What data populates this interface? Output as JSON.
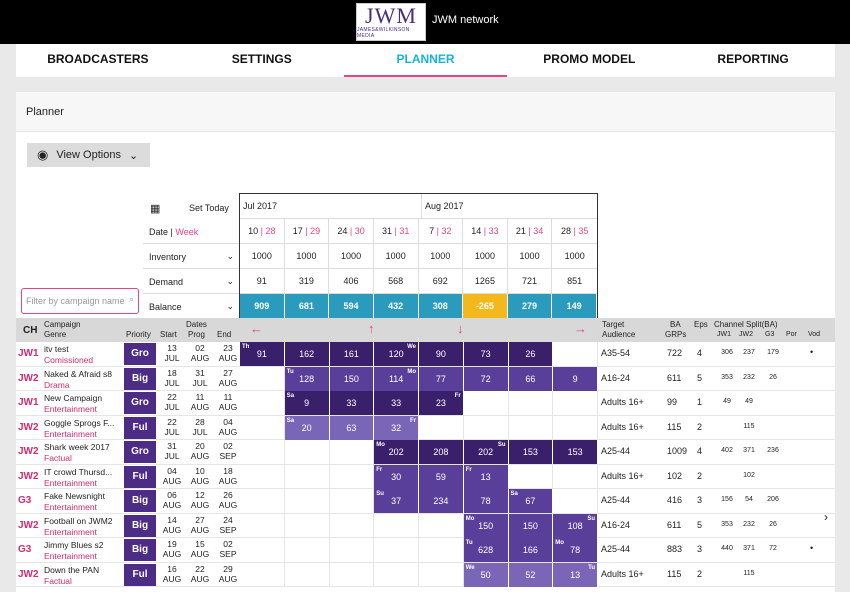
{
  "app": {
    "logo_text": "JWM",
    "logo_sub": "JAMES&WILKINSON MEDIA",
    "brand": "JWM network"
  },
  "nav": [
    "BROADCASTERS",
    "SETTINGS",
    "PLANNER",
    "PROMO MODEL",
    "REPORTING"
  ],
  "panel": {
    "title": "Planner",
    "view_options": "View Options",
    "filter_placeholder": "Filter by campaign name",
    "set_today": "Set Today"
  },
  "months": {
    "jul": "Jul 2017",
    "aug": "Aug 2017"
  },
  "row_labels": {
    "date": "Date",
    "week": "Week",
    "inventory": "Inventory",
    "demand": "Demand",
    "balance": "Balance"
  },
  "weeks": [
    {
      "d": "10",
      "w": "28"
    },
    {
      "d": "17",
      "w": "29"
    },
    {
      "d": "24",
      "w": "30"
    },
    {
      "d": "31",
      "w": "31"
    },
    {
      "d": "7",
      "w": "32"
    },
    {
      "d": "14",
      "w": "33"
    },
    {
      "d": "21",
      "w": "34"
    },
    {
      "d": "28",
      "w": "35"
    }
  ],
  "inventory": [
    "1000",
    "1000",
    "1000",
    "1000",
    "1000",
    "1000",
    "1000",
    "1000"
  ],
  "demand": [
    "91",
    "319",
    "406",
    "568",
    "692",
    "1265",
    "721",
    "851"
  ],
  "balance": [
    "909",
    "681",
    "594",
    "432",
    "308",
    "-265",
    "279",
    "149"
  ],
  "table_headers": {
    "ch": "CH",
    "campaign": "Campaign",
    "genre": "Genre",
    "priority": "Priority",
    "dates": "Dates",
    "start": "Start",
    "prog": "Prog",
    "end": "End",
    "target": "Target",
    "audience": "Audience",
    "ba": "BA",
    "grps": "GRPs",
    "eps": "Eps",
    "split": "Channel Split(BA)",
    "jw1": "JW1",
    "jw2": "JW2",
    "g3": "G3",
    "por": "Por",
    "vod": "Vod"
  },
  "rows": [
    {
      "ch": "JW1",
      "name": "itv test",
      "genre": "Comissioned",
      "prio": "Gro",
      "s": [
        "13",
        "JUL"
      ],
      "p": [
        "02",
        "AUG"
      ],
      "e": [
        "23",
        "AUG"
      ],
      "ta": "A35-54",
      "grp": "722",
      "eps": "4",
      "jw1": "306",
      "jw2": "237",
      "g3": "179",
      "vod": "•",
      "cells": [
        {
          "v": "91",
          "c": "c1",
          "dn": "Th"
        },
        {
          "v": "162",
          "c": "c1"
        },
        {
          "v": "161",
          "c": "c1"
        },
        {
          "v": "120",
          "c": "c1",
          "dnr": "We"
        },
        {
          "v": "90",
          "c": "c1"
        },
        {
          "v": "73",
          "c": "c1"
        },
        {
          "v": "26",
          "c": "c1"
        },
        {
          "v": ""
        }
      ]
    },
    {
      "ch": "JW2",
      "name": "Naked & Afraid s8",
      "genre": "Drama",
      "prio": "Big",
      "s": [
        "18",
        "JUL"
      ],
      "p": [
        "31",
        "JUL"
      ],
      "e": [
        "27",
        "AUG"
      ],
      "ta": "A16-24",
      "grp": "611",
      "eps": "5",
      "jw1": "353",
      "jw2": "232",
      "g3": "26",
      "vod": "",
      "cells": [
        {
          "v": ""
        },
        {
          "v": "128",
          "c": "c2",
          "dn": "Tu"
        },
        {
          "v": "150",
          "c": "c2"
        },
        {
          "v": "114",
          "c": "c2",
          "dnr": "Mo"
        },
        {
          "v": "77",
          "c": "c2"
        },
        {
          "v": "72",
          "c": "c2"
        },
        {
          "v": "66",
          "c": "c2"
        },
        {
          "v": "9",
          "c": "c2"
        }
      ]
    },
    {
      "ch": "JW1",
      "name": "New Campaign",
      "genre": "Entertainment",
      "prio": "Gro",
      "s": [
        "22",
        "JUL"
      ],
      "p": [
        "11",
        "AUG"
      ],
      "e": [
        "11",
        "AUG"
      ],
      "ta": "Adults 16+",
      "grp": "99",
      "eps": "1",
      "jw1": "49",
      "jw2": "49",
      "g3": "",
      "vod": "",
      "cells": [
        {
          "v": ""
        },
        {
          "v": "9",
          "c": "c1",
          "dn": "Sa"
        },
        {
          "v": "33",
          "c": "c1"
        },
        {
          "v": "33",
          "c": "c1"
        },
        {
          "v": "23",
          "c": "c1",
          "dnr": "Fr"
        },
        {
          "v": ""
        },
        {
          "v": ""
        },
        {
          "v": ""
        }
      ]
    },
    {
      "ch": "JW2",
      "name": "Goggle Sprogs F...",
      "genre": "Entertainment",
      "prio": "Ful",
      "s": [
        "22",
        "JUL"
      ],
      "p": [
        "28",
        "JUL"
      ],
      "e": [
        "04",
        "AUG"
      ],
      "ta": "Adults 16+",
      "grp": "115",
      "eps": "2",
      "jw1": "",
      "jw2": "115",
      "g3": "",
      "vod": "",
      "cells": [
        {
          "v": ""
        },
        {
          "v": "20",
          "c": "c3",
          "dn": "Sa"
        },
        {
          "v": "63",
          "c": "c3"
        },
        {
          "v": "32",
          "c": "c3",
          "dnr": "Fr"
        },
        {
          "v": ""
        },
        {
          "v": ""
        },
        {
          "v": ""
        },
        {
          "v": ""
        }
      ]
    },
    {
      "ch": "JW2",
      "name": "Shark week 2017",
      "genre": "Factual",
      "prio": "Gro",
      "s": [
        "31",
        "JUL"
      ],
      "p": [
        "20",
        "AUG"
      ],
      "e": [
        "02",
        "SEP"
      ],
      "ta": "A25-44",
      "grp": "1009",
      "eps": "4",
      "jw1": "402",
      "jw2": "371",
      "g3": "236",
      "vod": "",
      "cells": [
        {
          "v": ""
        },
        {
          "v": ""
        },
        {
          "v": ""
        },
        {
          "v": "202",
          "c": "c1",
          "dn": "Mo"
        },
        {
          "v": "208",
          "c": "c1"
        },
        {
          "v": "202",
          "c": "c1",
          "dnr": "Su"
        },
        {
          "v": "153",
          "c": "c1"
        },
        {
          "v": "153",
          "c": "c1"
        }
      ]
    },
    {
      "ch": "JW2",
      "name": "IT crowd Thursd...",
      "genre": "Entertainment",
      "prio": "Ful",
      "s": [
        "04",
        "AUG"
      ],
      "p": [
        "10",
        "AUG"
      ],
      "e": [
        "18",
        "AUG"
      ],
      "ta": "Adults 16+",
      "grp": "102",
      "eps": "2",
      "jw1": "",
      "jw2": "102",
      "g3": "",
      "vod": "",
      "cells": [
        {
          "v": ""
        },
        {
          "v": ""
        },
        {
          "v": ""
        },
        {
          "v": "30",
          "c": "c2",
          "dn": "Fr"
        },
        {
          "v": "59",
          "c": "c2"
        },
        {
          "v": "13",
          "c": "c2",
          "dn": "Fr"
        },
        {
          "v": ""
        },
        {
          "v": ""
        }
      ]
    },
    {
      "ch": "G3",
      "name": "Fake Newsnight",
      "genre": "Entertainment",
      "prio": "Big",
      "s": [
        "06",
        "AUG"
      ],
      "p": [
        "12",
        "AUG"
      ],
      "e": [
        "26",
        "AUG"
      ],
      "ta": "A25-44",
      "grp": "416",
      "eps": "3",
      "jw1": "156",
      "jw2": "54",
      "g3": "206",
      "vod": "",
      "cells": [
        {
          "v": ""
        },
        {
          "v": ""
        },
        {
          "v": ""
        },
        {
          "v": "37",
          "c": "c2",
          "dn": "Su"
        },
        {
          "v": "234",
          "c": "c2"
        },
        {
          "v": "78",
          "c": "c2"
        },
        {
          "v": "67",
          "c": "c2",
          "dn": "Sa"
        },
        {
          "v": ""
        }
      ]
    },
    {
      "ch": "JW2",
      "name": "Football on JWM2",
      "genre": "Entertainment",
      "prio": "Big",
      "s": [
        "14",
        "AUG"
      ],
      "p": [
        "27",
        "AUG"
      ],
      "e": [
        "24",
        "SEP"
      ],
      "ta": "A16-24",
      "grp": "611",
      "eps": "5",
      "jw1": "353",
      "jw2": "232",
      "g3": "26",
      "vod": "",
      "cells": [
        {
          "v": ""
        },
        {
          "v": ""
        },
        {
          "v": ""
        },
        {
          "v": ""
        },
        {
          "v": ""
        },
        {
          "v": "150",
          "c": "c2",
          "dn": "Mo"
        },
        {
          "v": "150",
          "c": "c2"
        },
        {
          "v": "108",
          "c": "c2",
          "dnr": "Su"
        }
      ]
    },
    {
      "ch": "G3",
      "name": "Jimmy Blues s2",
      "genre": "Entertainment",
      "prio": "Big",
      "s": [
        "19",
        "AUG"
      ],
      "p": [
        "15",
        "AUG"
      ],
      "e": [
        "02",
        "SEP"
      ],
      "ta": "A25-44",
      "grp": "883",
      "eps": "3",
      "jw1": "440",
      "jw2": "371",
      "g3": "72",
      "vod": "•",
      "cells": [
        {
          "v": ""
        },
        {
          "v": ""
        },
        {
          "v": ""
        },
        {
          "v": ""
        },
        {
          "v": ""
        },
        {
          "v": "628",
          "c": "c2",
          "dn": "Tu"
        },
        {
          "v": "166",
          "c": "c2"
        },
        {
          "v": "78",
          "c": "c2",
          "dn": "Mo"
        }
      ]
    },
    {
      "ch": "JW2",
      "name": "Down the PAN",
      "genre": "Factual",
      "prio": "Ful",
      "s": [
        "16",
        "AUG"
      ],
      "p": [
        "22",
        "AUG"
      ],
      "e": [
        "29",
        "AUG"
      ],
      "ta": "Adults 16+",
      "grp": "115",
      "eps": "2",
      "jw1": "",
      "jw2": "115",
      "g3": "",
      "vod": "",
      "cells": [
        {
          "v": ""
        },
        {
          "v": ""
        },
        {
          "v": ""
        },
        {
          "v": ""
        },
        {
          "v": ""
        },
        {
          "v": "50",
          "c": "c3",
          "dn": "We"
        },
        {
          "v": "52",
          "c": "c3"
        },
        {
          "v": "13",
          "c": "c3",
          "dnr": "Tu"
        }
      ]
    }
  ]
}
